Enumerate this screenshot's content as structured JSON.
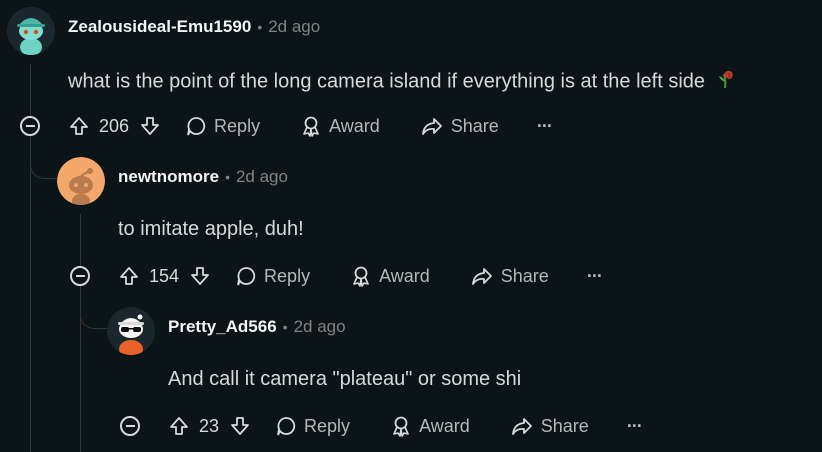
{
  "comments": [
    {
      "author": "Zealousideal-Emu1590",
      "separator": "•",
      "age": "2d ago",
      "body": "what is the point of the long camera island if everything is at the left side",
      "score": "206",
      "reply_label": "Reply",
      "award_label": "Award",
      "share_label": "Share",
      "more_label": "···"
    },
    {
      "author": "newtnomore",
      "separator": "•",
      "age": "2d ago",
      "body": "to imitate apple, duh!",
      "score": "154",
      "reply_label": "Reply",
      "award_label": "Award",
      "share_label": "Share",
      "more_label": "···"
    },
    {
      "author": "Pretty_Ad566",
      "separator": "•",
      "age": "2d ago",
      "body": "And call it camera \"plateau\" or some shi",
      "score": "23",
      "reply_label": "Reply",
      "award_label": "Award",
      "share_label": "Share",
      "more_label": "···"
    }
  ],
  "colors": {
    "background": "#0b1416",
    "thread_line": "#343536",
    "muted_text": "#818384"
  },
  "icons": [
    "upvote-icon",
    "downvote-icon",
    "reply-bubble-icon",
    "award-icon",
    "share-arrow-icon",
    "more-icon",
    "collapse-icon",
    "wilted-rose-emoji"
  ]
}
